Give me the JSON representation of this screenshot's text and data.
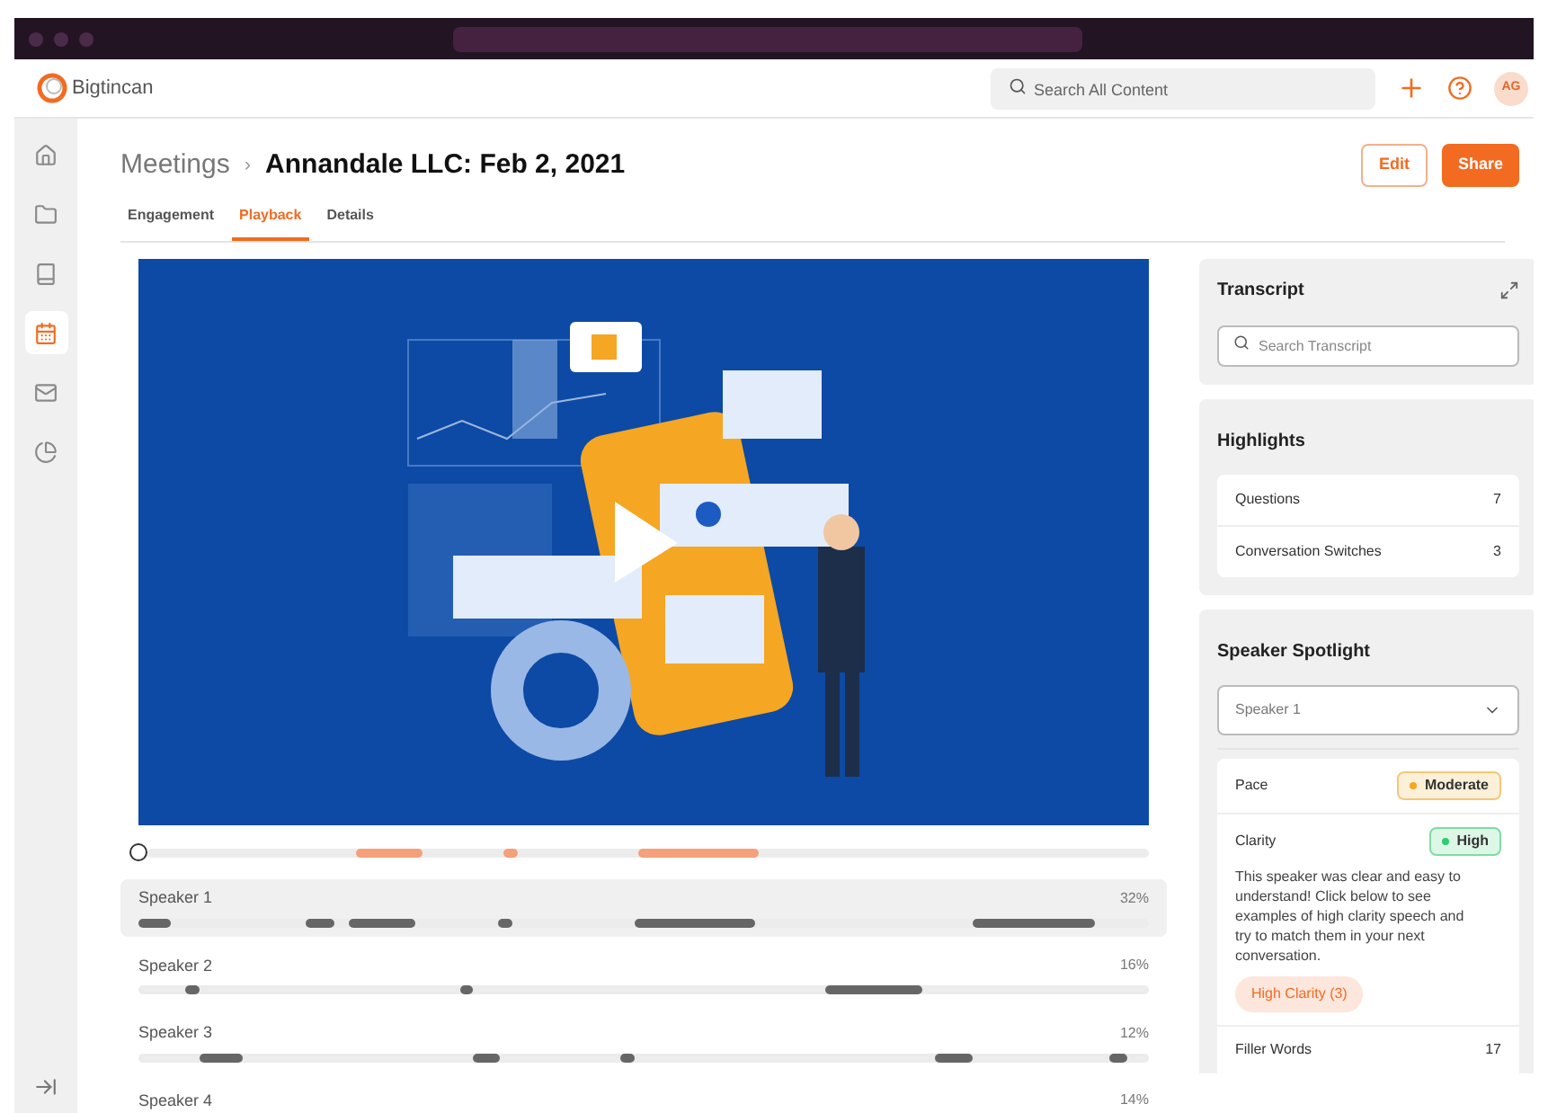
{
  "header": {
    "logo": "Bigtincan",
    "search": {
      "placeholder": "Search All Content"
    },
    "avatar": "AG"
  },
  "sidebar": {
    "items": [
      {
        "kind": "home",
        "selected": false
      },
      {
        "kind": "folder",
        "selected": false
      },
      {
        "kind": "book",
        "selected": false
      },
      {
        "kind": "calendar",
        "selected": true
      },
      {
        "kind": "mail",
        "selected": false
      },
      {
        "kind": "pie",
        "selected": false
      }
    ]
  },
  "breadcrumb": {
    "parent": "Meetings",
    "separator": "›",
    "current": "Annandale LLC: Feb 2, 2021"
  },
  "actions": [
    "Edit",
    "Share"
  ],
  "tabs": [
    {
      "label": "Engagement",
      "selected": false
    },
    {
      "label": "Playback",
      "selected": true
    },
    {
      "label": "Details",
      "selected": false
    }
  ],
  "speakers": [
    {
      "name": "Speaker 1",
      "percent": "32%",
      "selected": true
    },
    {
      "name": "Speaker 2",
      "percent": "16%",
      "selected": false
    },
    {
      "name": "Speaker 3",
      "percent": "12%",
      "selected": false
    },
    {
      "name": "Speaker 4",
      "percent": "14%",
      "selected": false
    }
  ],
  "transcript": {
    "title": "Transcript",
    "search": {
      "placeholder": "Search Transcript"
    }
  },
  "highlights": {
    "title": "Highlights",
    "rows": [
      {
        "label": "Questions",
        "count": "7"
      },
      {
        "label": "Conversation Switches",
        "count": "3"
      }
    ]
  },
  "spotlight": {
    "title": "Speaker Spotlight",
    "select": "Speaker 1",
    "metrics": [
      {
        "kind": "badge",
        "label": "Pace",
        "badge": "Moderate",
        "color": "#f5a623"
      },
      {
        "kind": "detail",
        "label": "Clarity",
        "badge": "High",
        "color": "#2ecc71",
        "text": "This speaker was clear and easy to understand! Click below to see examples of high clarity speech and try to match them in your next conversation.",
        "link": "High Clarity (3)"
      },
      {
        "kind": "count",
        "label": "Filler Words",
        "count": "17"
      }
    ]
  }
}
